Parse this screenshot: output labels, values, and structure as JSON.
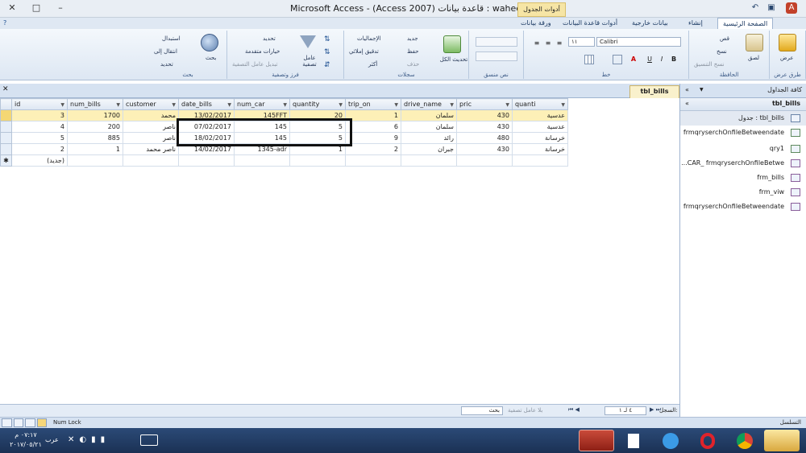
{
  "window": {
    "title": "Microsoft Access - (Access 2007) قاعدة بيانات : waheed",
    "context_tab": "أدوات الجدول",
    "min": "–",
    "max": "□",
    "close": "✕"
  },
  "tabs": [
    "الصفحة الرئيسية",
    "إنشاء",
    "بيانات خارجية",
    "أدوات قاعدة البيانات",
    "ورقة بيانات"
  ],
  "ribbon": {
    "views": {
      "label": "عرض",
      "group": "طرق عرض"
    },
    "clipboard": {
      "cut": "قص",
      "copy": "نسخ",
      "paste": "لصق",
      "format_painter": "نسخ التنسيق",
      "group": "الحافظة"
    },
    "font": {
      "name": "Calibri",
      "size": "١١",
      "bold": "B",
      "italic": "I",
      "underline": "U",
      "color": "A",
      "group": "خط"
    },
    "richtext": {
      "group": "نص منسق"
    },
    "records": {
      "refresh": "تحديث الكل",
      "new": "جديد",
      "save": "حفظ",
      "delete": "حذف",
      "totals": "الإجماليات",
      "spelling": "تدقيق إملائي",
      "more": "أكثر",
      "group": "سجلات"
    },
    "sort_filter": {
      "filter": "عامل تصفية",
      "selection": "تحديد",
      "advanced": "خيارات متقدمة",
      "toggle": "تبديل عامل التصفية",
      "group": "فرز وتصفية"
    },
    "find": {
      "find": "بحث",
      "replace": "استبدال",
      "goto": "انتقال إلى",
      "select": "تحديد",
      "group": "بحث"
    }
  },
  "document": {
    "tab": "tbl_bills",
    "close": "✕"
  },
  "grid": {
    "columns": [
      "id",
      "num_bills",
      "customer",
      "date_bills",
      "num_car",
      "quantity",
      "trip_on",
      "drive_name",
      "pric",
      "quanti"
    ],
    "rows": [
      [
        "3",
        "1700",
        "محمد",
        "13/02/2017",
        "145FFT",
        "20",
        "1",
        "سلمان",
        "430",
        "عدسية"
      ],
      [
        "4",
        "200",
        "ناصر",
        "07/02/2017",
        "145",
        "5",
        "6",
        "سلمان",
        "430",
        "عدسية"
      ],
      [
        "5",
        "885",
        "ناصر",
        "18/02/2017",
        "145",
        "5",
        "9",
        "رائد",
        "480",
        "خرسانة"
      ],
      [
        "2",
        "1",
        "ناصر محمد",
        "14/02/2017",
        "1345-adr",
        "1",
        "2",
        "جبران",
        "430",
        "خرسانة"
      ]
    ],
    "new_row": "(جديد)"
  },
  "recnav": {
    "label": "السجل:",
    "position": "٤ لـ ١",
    "filter": "بلا عامل تصفية",
    "search": "بحث"
  },
  "navpane": {
    "title": "كافة الجداول",
    "group": "tbl_bills",
    "items": [
      "tbl_bills : جدول",
      "frmqryserchOnfileBetweendate",
      "qry1",
      "CAR_ frmqryserchOnfileBetwe...",
      "frm_bills",
      "frm_viw",
      "frmqryserchOnfileBetweendate"
    ]
  },
  "status": {
    "left": "التسلسل",
    "numlock": "Num Lock"
  },
  "taskbar": {
    "time": "٠٧:١٧ م",
    "date": "٢٠١٧/٠٥/٢١",
    "lang": "عرب"
  }
}
